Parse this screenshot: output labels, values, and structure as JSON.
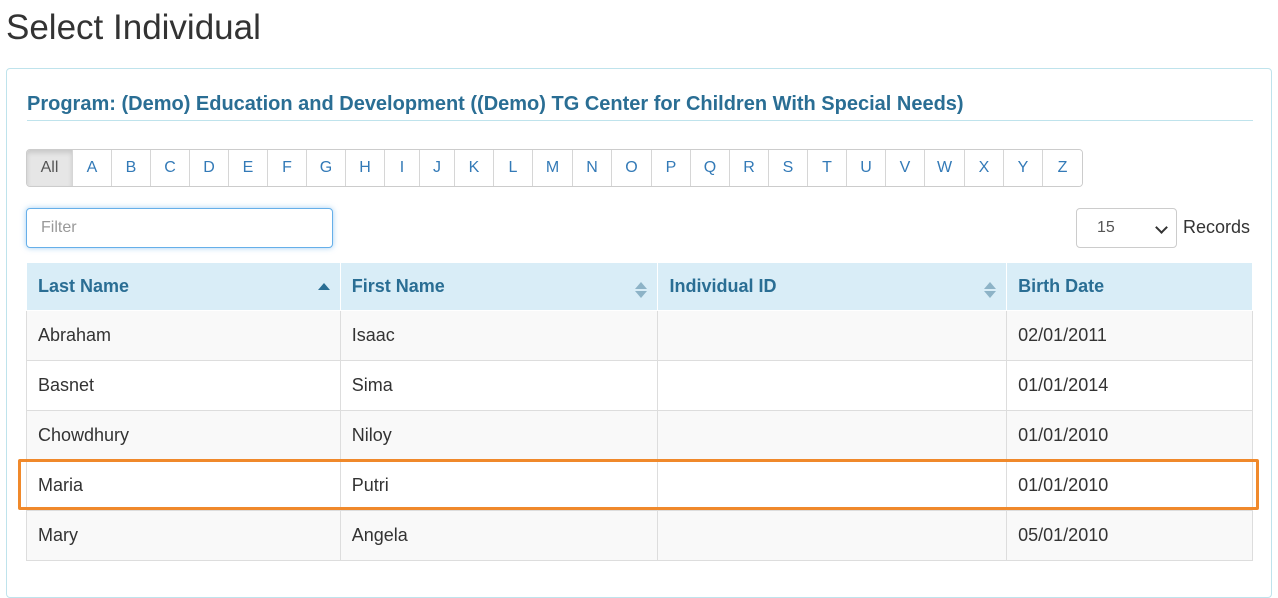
{
  "page": {
    "title": "Select Individual"
  },
  "program": {
    "title": "Program: (Demo) Education and Development ((Demo) TG Center for Children With Special Needs)"
  },
  "alphabet": [
    "All",
    "A",
    "B",
    "C",
    "D",
    "E",
    "F",
    "G",
    "H",
    "I",
    "J",
    "K",
    "L",
    "M",
    "N",
    "O",
    "P",
    "Q",
    "R",
    "S",
    "T",
    "U",
    "V",
    "W",
    "X",
    "Y",
    "Z"
  ],
  "alphabet_active": "All",
  "filter": {
    "placeholder": "Filter",
    "value": ""
  },
  "records": {
    "selected": "15",
    "label": "Records"
  },
  "table": {
    "columns": [
      "Last Name",
      "First Name",
      "Individual ID",
      "Birth Date"
    ],
    "rows": [
      [
        "Abraham",
        "Isaac",
        "",
        "02/01/2011"
      ],
      [
        "Basnet",
        "Sima",
        "",
        "01/01/2014"
      ],
      [
        "Chowdhury",
        "Niloy",
        "",
        "01/01/2010"
      ],
      [
        "Maria",
        "Putri",
        "",
        "01/01/2010"
      ],
      [
        "Mary",
        "Angela",
        "",
        "05/01/2010"
      ]
    ],
    "highlighted_row_index": 3
  },
  "colors": {
    "accent": "#2a6e94",
    "header_bg": "#d9edf7",
    "highlight": "#f0892b",
    "link": "#337ab7"
  }
}
